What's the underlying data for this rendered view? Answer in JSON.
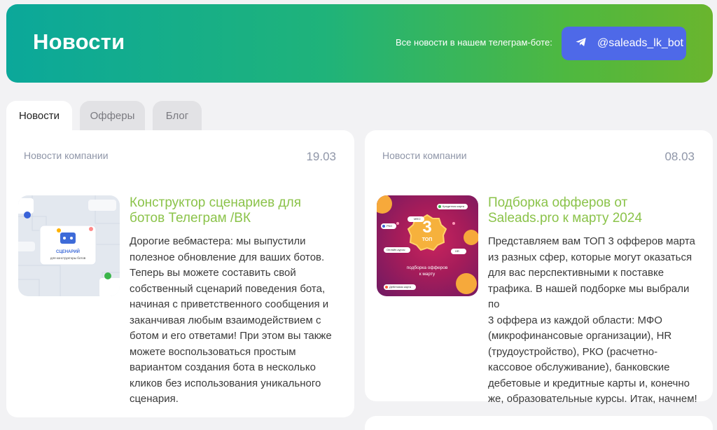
{
  "header": {
    "title": "Новости",
    "telegram_note": "Все новости в нашем телеграм-боте:",
    "telegram_button": "@saleads_lk_bot"
  },
  "tabs": [
    {
      "label": "Новости",
      "active": true
    },
    {
      "label": "Офферы",
      "active": false
    },
    {
      "label": "Блог",
      "active": false
    }
  ],
  "cards": [
    {
      "category": "Новости компании",
      "date": "19.03",
      "title_lines": [
        "Конструктор сценариев для",
        "ботов Телеграм /ВК"
      ],
      "body_lines": [
        "Дорогие вебмастера: мы выпустили",
        "полезное обновление для ваших ботов.",
        "Теперь вы можете составить свой",
        "собственный сценарий поведения бота,",
        "начиная с приветственного сообщения и",
        "заканчивая любым взаимодействием с",
        "ботом и его ответами! При этом вы также",
        "можете воспользоваться простым",
        "вариантом создания бота в несколько",
        "кликов без использования уникального",
        "сценария."
      ],
      "image": {
        "label_1": "СЦЕНАРИЙ",
        "label_2": "для конструкторы ботов"
      }
    },
    {
      "category": "Новости компании",
      "date": "08.03",
      "title_lines": [
        "Подборка офферов от",
        "Saleads.pro к марту 2024"
      ],
      "body_lines": [
        "Представляем вам ТОП 3 офферов марта",
        "из разных сфер, которые могут оказаться",
        "для вас перспективными к поставке",
        "трафика. В нашей подборке мы выбрали по",
        "3 оффера из каждой области: МФО",
        "(микрофинансовые организации), HR",
        "(трудоустройство), РКО (расчетно-",
        "кассовое обслуживание), банковские",
        "дебетовые и кредитные карты и, конечно",
        "же, образовательные курсы. Итак, начнем!"
      ],
      "image": {
        "number": "3",
        "top_label": "ТОП",
        "caption_1": "подборка офферов",
        "caption_2": "к марту",
        "tags": [
          "Кредитная карта",
          "МФО",
          "РКО",
          "Онлайн-курсы",
          "HR",
          "Дебетовая карта"
        ]
      }
    }
  ],
  "colors": {
    "accent_green": "#8bc34a",
    "telegram_blue": "#4e69e8",
    "muted_text": "#8f96a8"
  }
}
